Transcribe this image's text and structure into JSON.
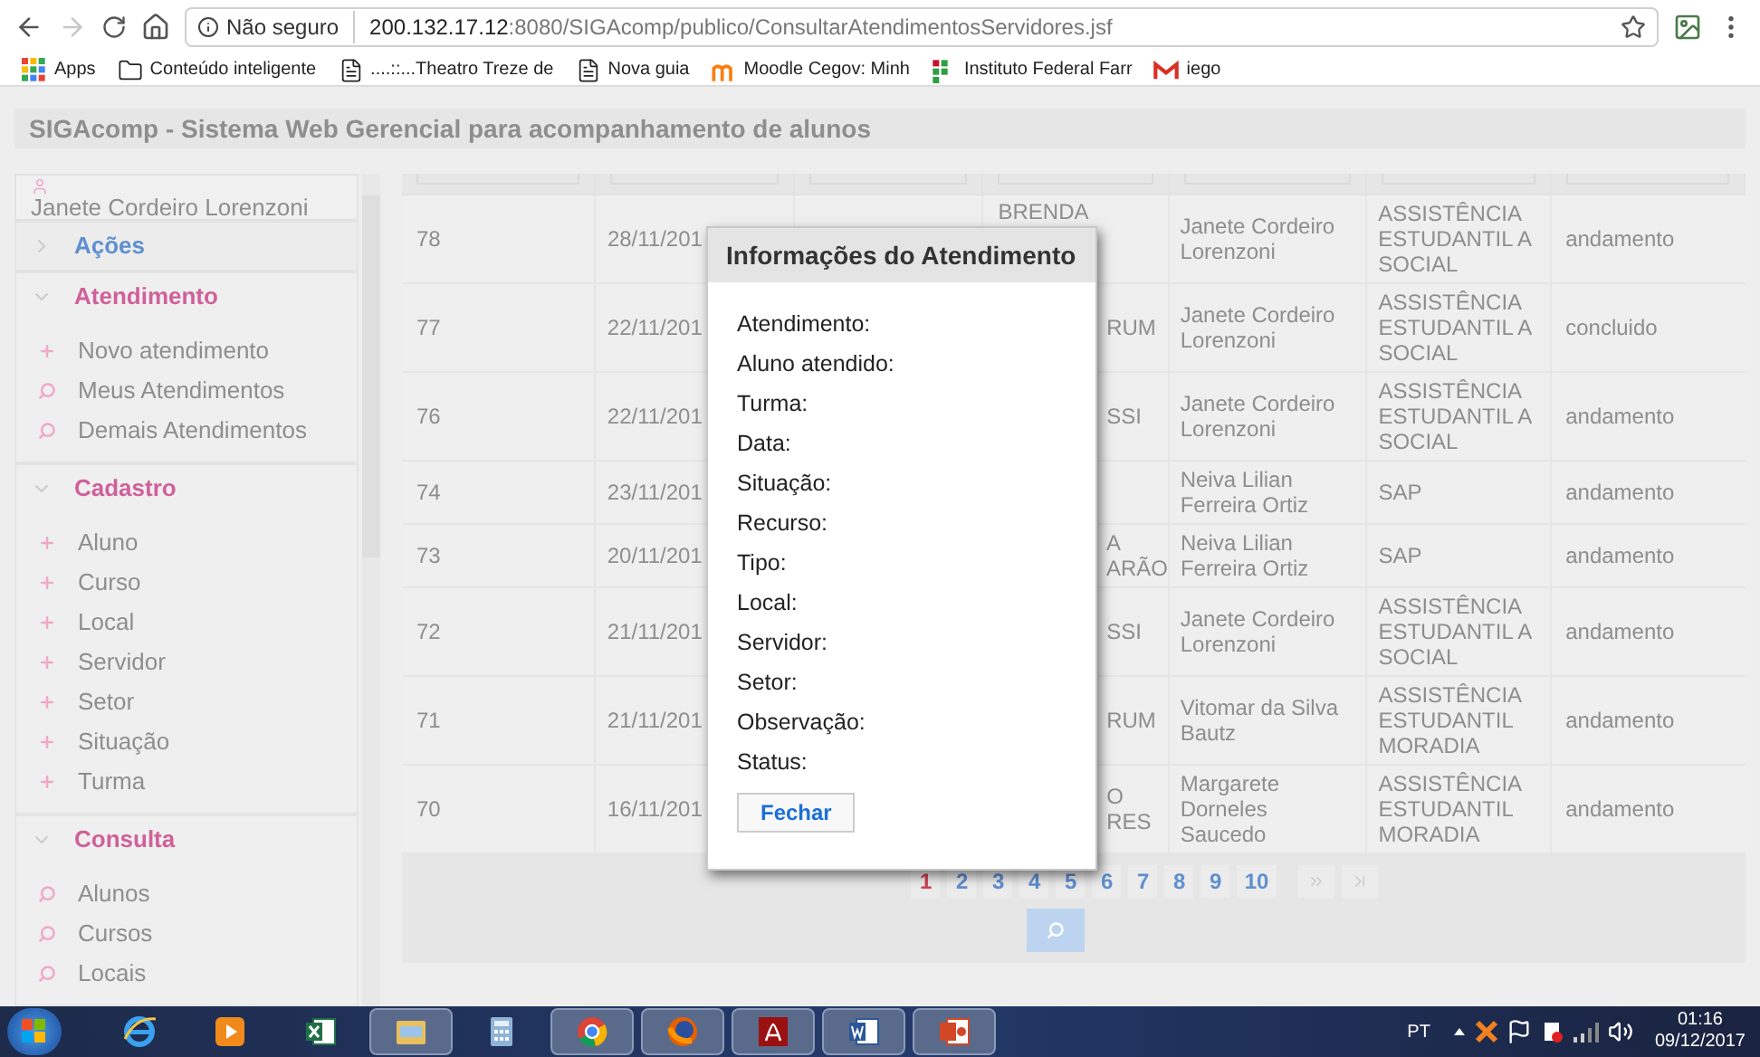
{
  "browser": {
    "security": "Não seguro",
    "url_host": "200.132.17.12",
    "url_path": ":8080/SIGAcomp/publico/ConsultarAtendimentosServidores.jsf",
    "forward_disabled": true
  },
  "bookmarks": [
    {
      "label": "Apps",
      "kind": "apps"
    },
    {
      "label": "Conteúdo inteligente",
      "kind": "folder"
    },
    {
      "label": "....::...Theatro Treze de",
      "kind": "page"
    },
    {
      "label": "Nova guia",
      "kind": "page"
    },
    {
      "label": "Moodle Cegov: Minh",
      "kind": "moodle"
    },
    {
      "label": "Instituto Federal Farr",
      "kind": "institute"
    },
    {
      "label": "iego",
      "kind": "mail"
    }
  ],
  "app_title": "SIGAcomp - Sistema Web Gerencial para acompanhamento de alunos",
  "sidebar": {
    "user": "Janete Cordeiro Lorenzoni",
    "sections": [
      {
        "title": "Ações",
        "expanded": false
      },
      {
        "title": "Atendimento",
        "expanded": true,
        "items": [
          {
            "label": "Novo atendimento",
            "kind": "add"
          },
          {
            "label": "Meus Atendimentos",
            "kind": "search"
          },
          {
            "label": "Demais Atendimentos",
            "kind": "search"
          }
        ]
      },
      {
        "title": "Cadastro",
        "expanded": true,
        "items": [
          {
            "label": "Aluno",
            "kind": "add"
          },
          {
            "label": "Curso",
            "kind": "add"
          },
          {
            "label": "Local",
            "kind": "add"
          },
          {
            "label": "Servidor",
            "kind": "add"
          },
          {
            "label": "Setor",
            "kind": "add"
          },
          {
            "label": "Situação",
            "kind": "add"
          },
          {
            "label": "Turma",
            "kind": "add"
          }
        ]
      },
      {
        "title": "Consulta",
        "expanded": true,
        "items": [
          {
            "label": "Alunos",
            "kind": "search"
          },
          {
            "label": "Cursos",
            "kind": "search"
          },
          {
            "label": "Locais",
            "kind": "search"
          }
        ]
      }
    ]
  },
  "table": {
    "rows": [
      {
        "id": "78",
        "date": "28/11/201",
        "student": [
          "BRENDA"
        ],
        "staff": "Janete Cordeiro Lorenzoni",
        "sector": "ASSISTÊNCIA ESTUDANTIL A SOCIAL",
        "status": "andamento"
      },
      {
        "id": "77",
        "date": "22/11/201",
        "student": [
          "RUM"
        ],
        "staff": "Janete Cordeiro Lorenzoni",
        "sector": "ASSISTÊNCIA ESTUDANTIL A SOCIAL",
        "status": "concluido"
      },
      {
        "id": "76",
        "date": "22/11/201",
        "student": [
          "SSI"
        ],
        "staff": "Janete Cordeiro Lorenzoni",
        "sector": "ASSISTÊNCIA ESTUDANTIL A SOCIAL",
        "status": "andamento"
      },
      {
        "id": "74",
        "date": "23/11/201",
        "student": [],
        "staff": "Neiva Lilian Ferreira Ortiz",
        "sector": "SAP",
        "status": "andamento"
      },
      {
        "id": "73",
        "date": "20/11/201",
        "student": [
          "A",
          "ARÃO"
        ],
        "staff": "Neiva Lilian Ferreira Ortiz",
        "sector": "SAP",
        "status": "andamento"
      },
      {
        "id": "72",
        "date": "21/11/201",
        "student": [
          "SSI"
        ],
        "staff": "Janete Cordeiro Lorenzoni",
        "sector": "ASSISTÊNCIA ESTUDANTIL A SOCIAL",
        "status": "andamento"
      },
      {
        "id": "71",
        "date": "21/11/201",
        "student": [
          "RUM"
        ],
        "staff": "Vitomar da Silva Bautz",
        "sector": "ASSISTÊNCIA ESTUDANTIL MORADIA",
        "status": "andamento"
      },
      {
        "id": "70",
        "date": "16/11/201",
        "student": [
          "O",
          "RES"
        ],
        "staff": "Margarete Dorneles Saucedo",
        "sector": "ASSISTÊNCIA ESTUDANTIL MORADIA",
        "status": "andamento"
      }
    ],
    "pages": [
      {
        "label": "1",
        "selected": true
      },
      {
        "label": "2",
        "selected": false
      },
      {
        "label": "3",
        "selected": false
      },
      {
        "label": "4",
        "selected": false
      },
      {
        "label": "5",
        "selected": false
      },
      {
        "label": "6",
        "selected": false
      },
      {
        "label": "7",
        "selected": false
      },
      {
        "label": "8",
        "selected": false
      },
      {
        "label": "9",
        "selected": false
      },
      {
        "label": "10",
        "selected": false
      }
    ]
  },
  "dialog": {
    "title": "Informações do Atendimento",
    "fields": [
      "Atendimento:",
      "Aluno atendido:",
      "Turma:",
      "Data:",
      "Situação:",
      "Recurso:",
      "Tipo:",
      "Local:",
      "Servidor:",
      "Setor:",
      "Observação:",
      "Status:"
    ],
    "close_button": "Fechar"
  },
  "taskbar": {
    "apps": [
      {
        "kind": "ie",
        "running": false
      },
      {
        "kind": "media",
        "running": false
      },
      {
        "kind": "excel",
        "running": false
      },
      {
        "kind": "explorer",
        "running": true
      },
      {
        "kind": "calculator",
        "running": false
      },
      {
        "kind": "chrome",
        "running": true
      },
      {
        "kind": "firefox",
        "running": true
      },
      {
        "kind": "acrobat",
        "running": true
      },
      {
        "kind": "word",
        "running": true
      },
      {
        "kind": "powerpoint",
        "running": true
      }
    ],
    "language": "PT",
    "time": "01:16",
    "date": "09/12/2017"
  }
}
